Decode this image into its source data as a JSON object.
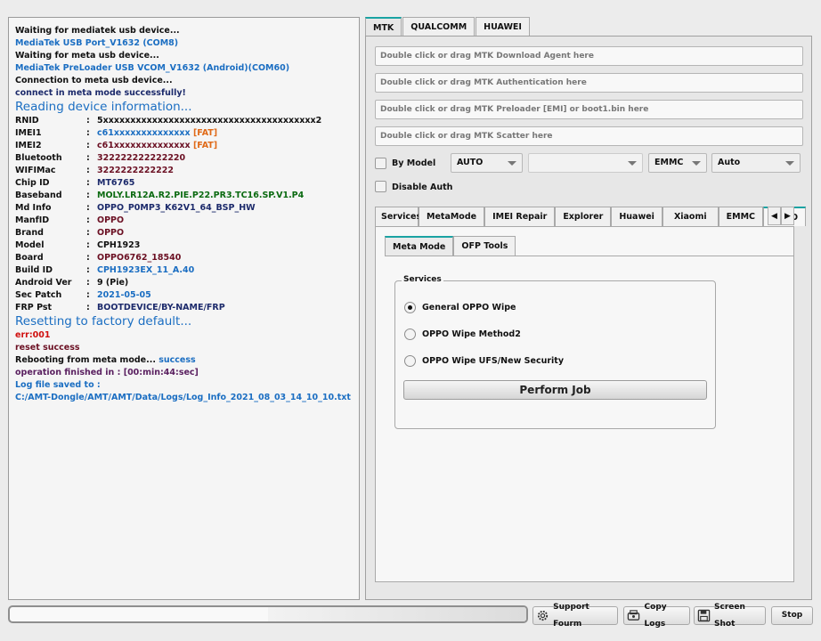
{
  "log": {
    "l1": "Waiting for mediatek usb device...",
    "l2": "MediaTek USB Port_V1632 (COM8)",
    "l3": "Waiting for meta usb device...",
    "l4": "MediaTek PreLoader USB VCOM_V1632 (Android)(COM60)",
    "l5": "Connection to meta usb device...",
    "l6": "connect in meta mode successfully!",
    "reading": "Reading device information...",
    "fields": [
      {
        "k": "RNID",
        "v": "5xxxxxxxxxxxxxxxxxxxxxxxxxxxxxxxxxxxxxxx2",
        "tag": ""
      },
      {
        "k": "IMEI1",
        "v": "c61xxxxxxxxxxxxxx",
        "tag": "[FAT]"
      },
      {
        "k": "IMEI2",
        "v": "c61xxxxxxxxxxxxxx",
        "tag": "[FAT]"
      },
      {
        "k": "Bluetooth",
        "v": "322222222222220",
        "tag": ""
      },
      {
        "k": "WIFIMac",
        "v": "3222222222222",
        "tag": ""
      },
      {
        "k": "Chip ID",
        "v": "MT6765",
        "tag": ""
      },
      {
        "k": "Baseband",
        "v": "MOLY.LR12A.R2.PIE.P22.PR3.TC16.SP.V1.P4",
        "tag": ""
      },
      {
        "k": "Md Info",
        "v": "OPPO_P0MP3_K62V1_64_BSP_HW",
        "tag": ""
      },
      {
        "k": "ManfID",
        "v": "OPPO",
        "tag": ""
      },
      {
        "k": "Brand",
        "v": "OPPO",
        "tag": ""
      },
      {
        "k": "Model",
        "v": "CPH1923",
        "tag": ""
      },
      {
        "k": "Board",
        "v": "OPPO6762_18540",
        "tag": ""
      },
      {
        "k": "Build ID",
        "v": "CPH1923EX_11_A.40",
        "tag": ""
      },
      {
        "k": "Android Ver",
        "v": "9 (Pie)",
        "tag": ""
      },
      {
        "k": "Sec Patch",
        "v": "2021-05-05",
        "tag": ""
      },
      {
        "k": "FRP Pst",
        "v": "BOOTDEVICE/BY-NAME/FRP",
        "tag": ""
      }
    ],
    "sep": ":",
    "resetting": "Resetting to factory default...",
    "err": "err:001",
    "reset_success": "reset success",
    "rebooting": "Rebooting from meta mode...",
    "rebooting_status": "success",
    "finished": "operation finished in : [00:min:44:sec]",
    "logsaved": "Log file saved to :",
    "logpath": "C:/AMT-Dongle/AMT/AMT/Data/Logs/Log_Info_2021_08_03_14_10_10.txt"
  },
  "top_tabs": [
    "MTK",
    "QUALCOMM",
    "HUAWEI"
  ],
  "paths": {
    "da": "Double click or drag MTK Download Agent here",
    "auth": "Double click or drag MTK Authentication here",
    "preloader": "Double click or drag MTK Preloader [EMI] or boot1.bin here",
    "scatter": "Double click or drag MTK Scatter here"
  },
  "options": {
    "by_model": "By Model",
    "combo1": "AUTO",
    "combo2": "",
    "combo3": "EMMC",
    "combo4": "Auto",
    "disable_auth": "Disable Auth"
  },
  "mid_tabs": [
    "Services",
    "MetaMode",
    "IMEI Repair",
    "Explorer",
    "Huawei",
    "Xiaomi",
    "EMMC",
    "OPPO"
  ],
  "sub_tabs": [
    "Meta Mode",
    "OFP Tools"
  ],
  "services": {
    "title": "Services",
    "opt1": "General OPPO Wipe",
    "opt2": "OPPO Wipe Method2",
    "opt3": "OPPO Wipe UFS/New Security",
    "perform": "Perform Job"
  },
  "bottom": {
    "support": "Support Fourm",
    "copy": "Copy Logs",
    "screenshot": "Screen Shot",
    "stop": "Stop"
  },
  "colors": {
    "accent": "#1aa3a3",
    "log_blue": "#1b6ec2",
    "error_red": "#d0100e",
    "fat_orange": "#e06a18"
  }
}
